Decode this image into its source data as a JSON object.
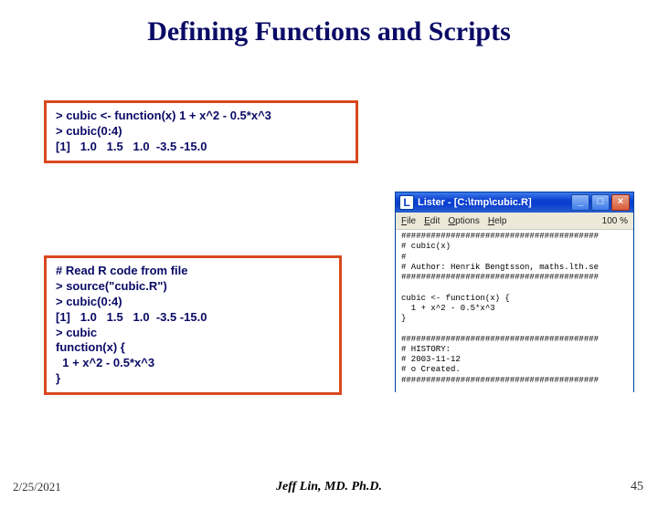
{
  "title": "Defining Functions and Scripts",
  "code1": "> cubic <- function(x) 1 + x^2 - 0.5*x^3\n> cubic(0:4)\n[1]   1.0   1.5   1.0  -3.5 -15.0",
  "code2": "# Read R code from file\n> source(\"cubic.R\")\n> cubic(0:4)\n[1]   1.0   1.5   1.0  -3.5 -15.0\n> cubic\nfunction(x) {\n  1 + x^2 - 0.5*x^3\n}",
  "window": {
    "title": "Lister - [C:\\tmp\\cubic.R]",
    "menus": [
      "File",
      "Edit",
      "Options",
      "Help"
    ],
    "zoom": "100 %",
    "content": "########################################\n# cubic(x)\n#\n# Author: Henrik Bengtsson, maths.lth.se\n########################################\n\ncubic <- function(x) {\n  1 + x^2 - 0.5*x^3\n}\n\n########################################\n# HISTORY:\n# 2003-11-12\n# o Created.\n########################################"
  },
  "footer": {
    "date": "2/25/2021",
    "author": "Jeff Lin, MD. Ph.D.",
    "page": "45"
  }
}
